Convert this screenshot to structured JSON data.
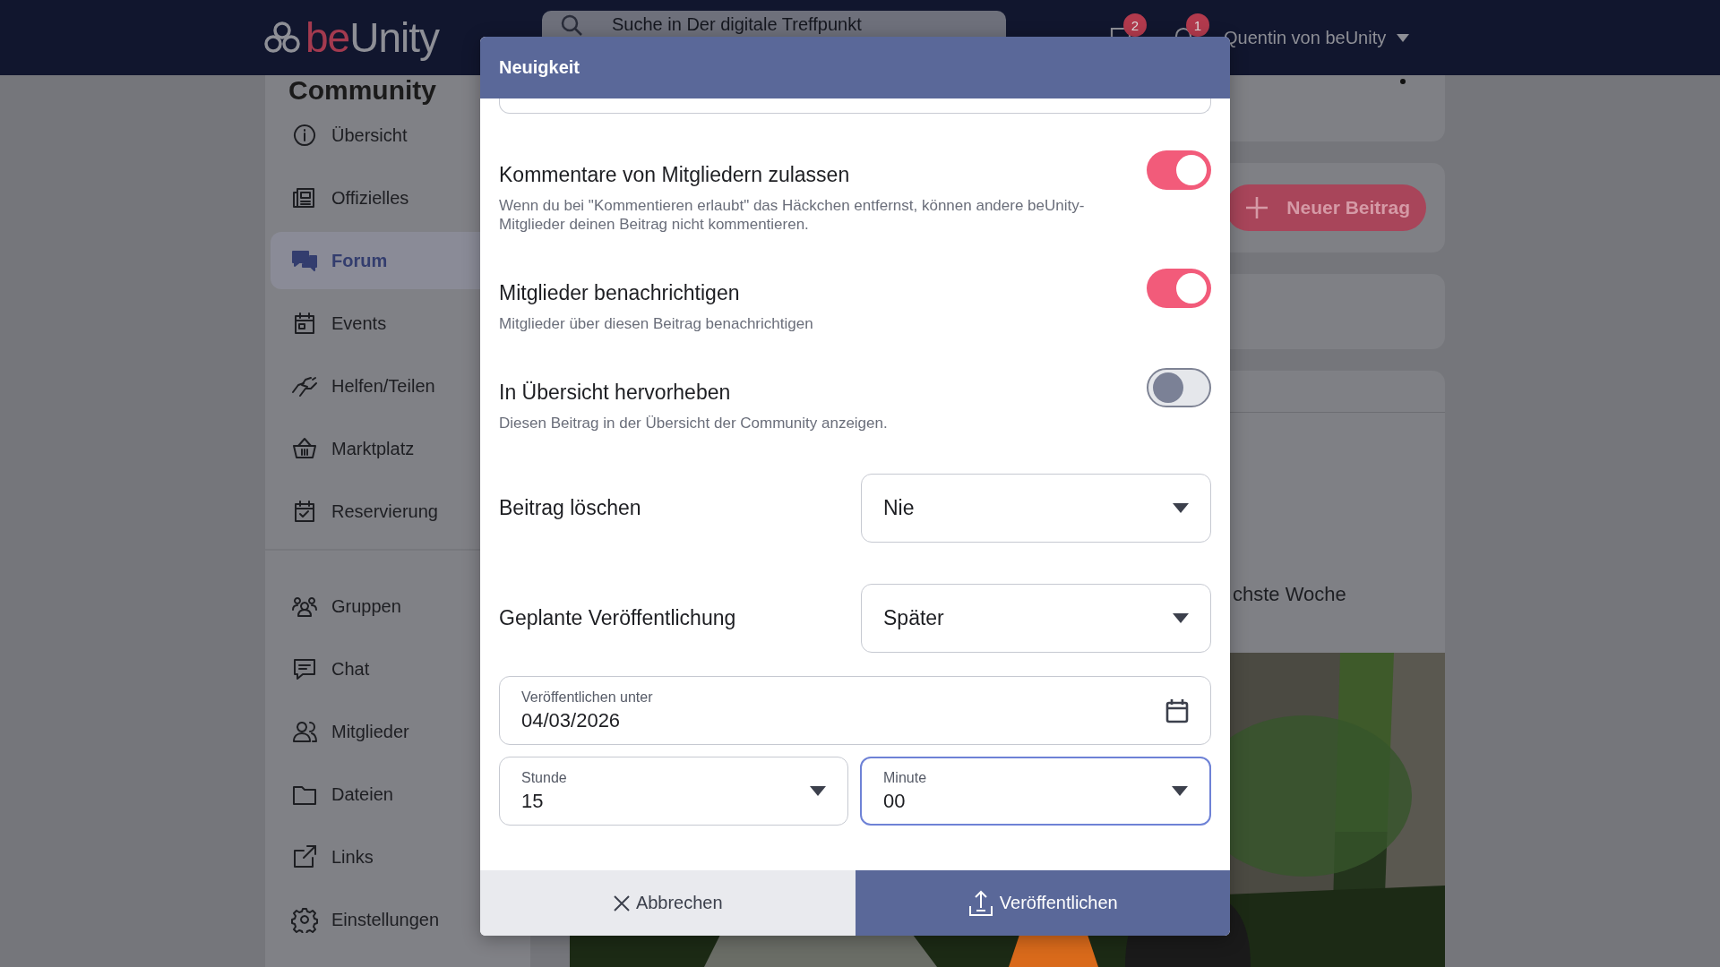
{
  "topbar": {
    "logo": {
      "accent": "be",
      "name": "Unity"
    },
    "search": {
      "placeholder": "Suche in Der digitale Treffpunkt"
    },
    "chat_badge": "2",
    "notification_badge": "1",
    "user": "Quentin von beUnity"
  },
  "sidebar": {
    "title": "Community",
    "groups": [
      [
        {
          "label": "Übersicht",
          "selected": false
        },
        {
          "label": "Offizielles",
          "selected": false
        },
        {
          "label": "Forum",
          "selected": true
        },
        {
          "label": "Events",
          "selected": false
        },
        {
          "label": "Helfen/Teilen",
          "selected": false
        },
        {
          "label": "Marktplatz",
          "selected": false
        },
        {
          "label": "Reservierung",
          "selected": false
        }
      ],
      [
        {
          "label": "Gruppen",
          "selected": false
        },
        {
          "label": "Chat",
          "selected": false
        },
        {
          "label": "Mitglieder",
          "selected": false
        },
        {
          "label": "Dateien",
          "selected": false
        },
        {
          "label": "Links",
          "selected": false
        },
        {
          "label": "Einstellungen",
          "selected": false
        }
      ]
    ]
  },
  "main": {
    "new_post_button": "Neuer Beitrag",
    "post_text": "chste Woche"
  },
  "dialog": {
    "title": "Neuigkeit",
    "toggles": [
      {
        "label": "Kommentare von Mitgliedern zulassen",
        "description": "Wenn du bei \"Kommentieren erlaubt\" das Häckchen entfernst, können andere beUnity-Mitglieder deinen Beitrag nicht kommentieren.",
        "on": true
      },
      {
        "label": "Mitglieder benachrichtigen",
        "description": "Mitglieder über diesen Beitrag benachrichtigen",
        "on": true
      },
      {
        "label": "In Übersicht hervorheben",
        "description": "Diesen Beitrag in der Übersicht der Community anzeigen.",
        "on": false
      }
    ],
    "selects": [
      {
        "label": "Beitrag löschen",
        "value": "Nie"
      },
      {
        "label": "Geplante Veröffentlichung",
        "value": "Später"
      }
    ],
    "date_field": {
      "label": "Veröffentlichen unter",
      "value": "04/03/2026"
    },
    "time_fields": [
      {
        "label": "Stunde",
        "value": "15",
        "focused": false
      },
      {
        "label": "Minute",
        "value": "00",
        "focused": true
      }
    ],
    "cancel_button": "Abbrechen",
    "publish_button": "Veröffentlichen"
  }
}
